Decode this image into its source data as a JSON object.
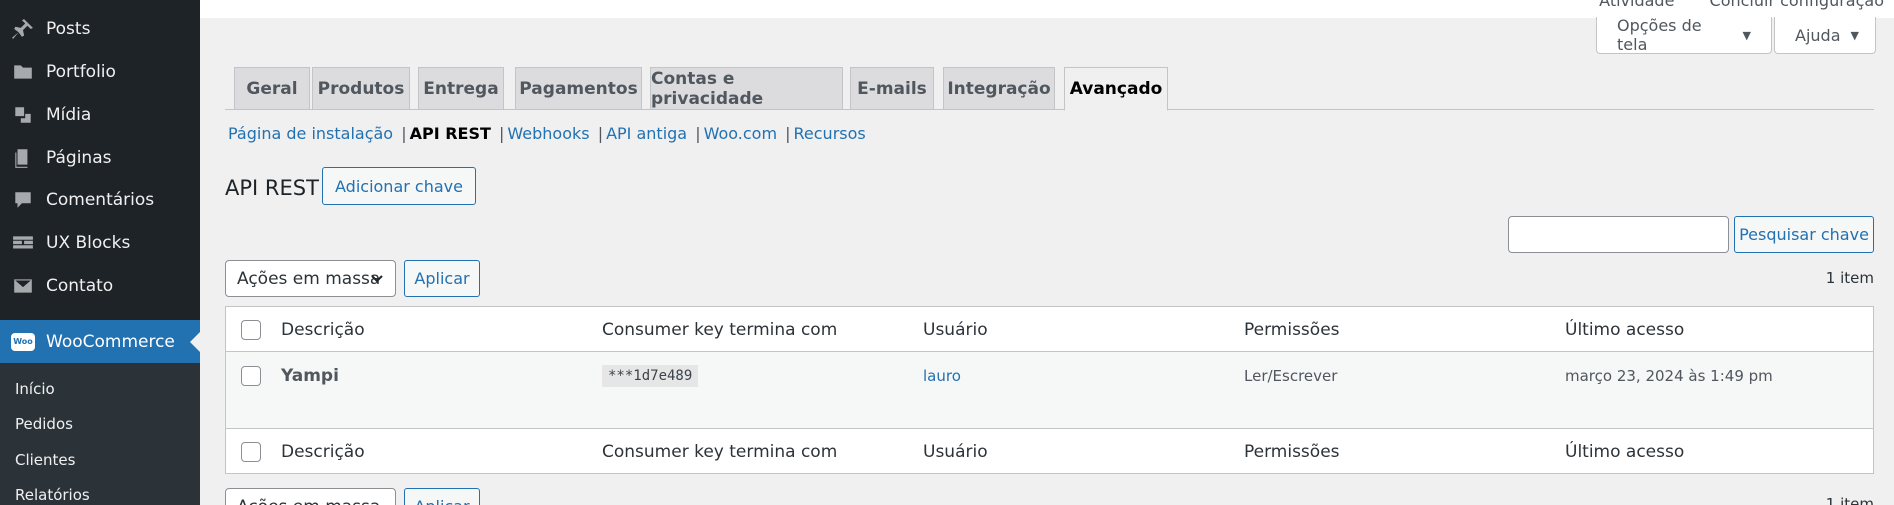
{
  "sidebar": {
    "items": [
      {
        "label": "Posts",
        "icon": "pin-icon"
      },
      {
        "label": "Portfolio",
        "icon": "folder-icon"
      },
      {
        "label": "Mídia",
        "icon": "media-icon"
      },
      {
        "label": "Páginas",
        "icon": "pages-icon"
      },
      {
        "label": "Comentários",
        "icon": "comment-icon"
      },
      {
        "label": "UX Blocks",
        "icon": "blocks-icon"
      },
      {
        "label": "Contato",
        "icon": "mail-icon"
      },
      {
        "label": "WooCommerce",
        "icon": "woo-icon",
        "logo_text": "Woo"
      }
    ],
    "submenu": [
      "Início",
      "Pedidos",
      "Clientes",
      "Relatórios"
    ]
  },
  "topbar": {
    "links": [
      "Atividade",
      "Concluir configuração"
    ]
  },
  "screen_options": {
    "label": "Opções de tela",
    "help": "Ajuda"
  },
  "tabs": [
    "Geral",
    "Produtos",
    "Entrega",
    "Pagamentos",
    "Contas e privacidade",
    "E-mails",
    "Integração",
    "Avançado"
  ],
  "sublinks": [
    "Página de instalação",
    "API REST",
    "Webhooks",
    "API antiga",
    "Woo.com",
    "Recursos"
  ],
  "page": {
    "title": "API REST",
    "add_key": "Adicionar chave"
  },
  "search": {
    "button": "Pesquisar chave",
    "placeholder": ""
  },
  "bulk": {
    "select": "Ações em massa",
    "apply": "Aplicar",
    "count": "1 item"
  },
  "table": {
    "headers": [
      "Descrição",
      "Consumer key termina com",
      "Usuário",
      "Permissões",
      "Último acesso"
    ],
    "rows": [
      {
        "description": "Yampi",
        "key": "***1d7e489",
        "user": "lauro",
        "permissions": "Ler/Escrever",
        "last_access": "março 23, 2024 às 1:49 pm"
      }
    ]
  },
  "colors": {
    "accent": "#2271b1",
    "sidebar": "#1d2327",
    "background": "#f0f0f1"
  }
}
